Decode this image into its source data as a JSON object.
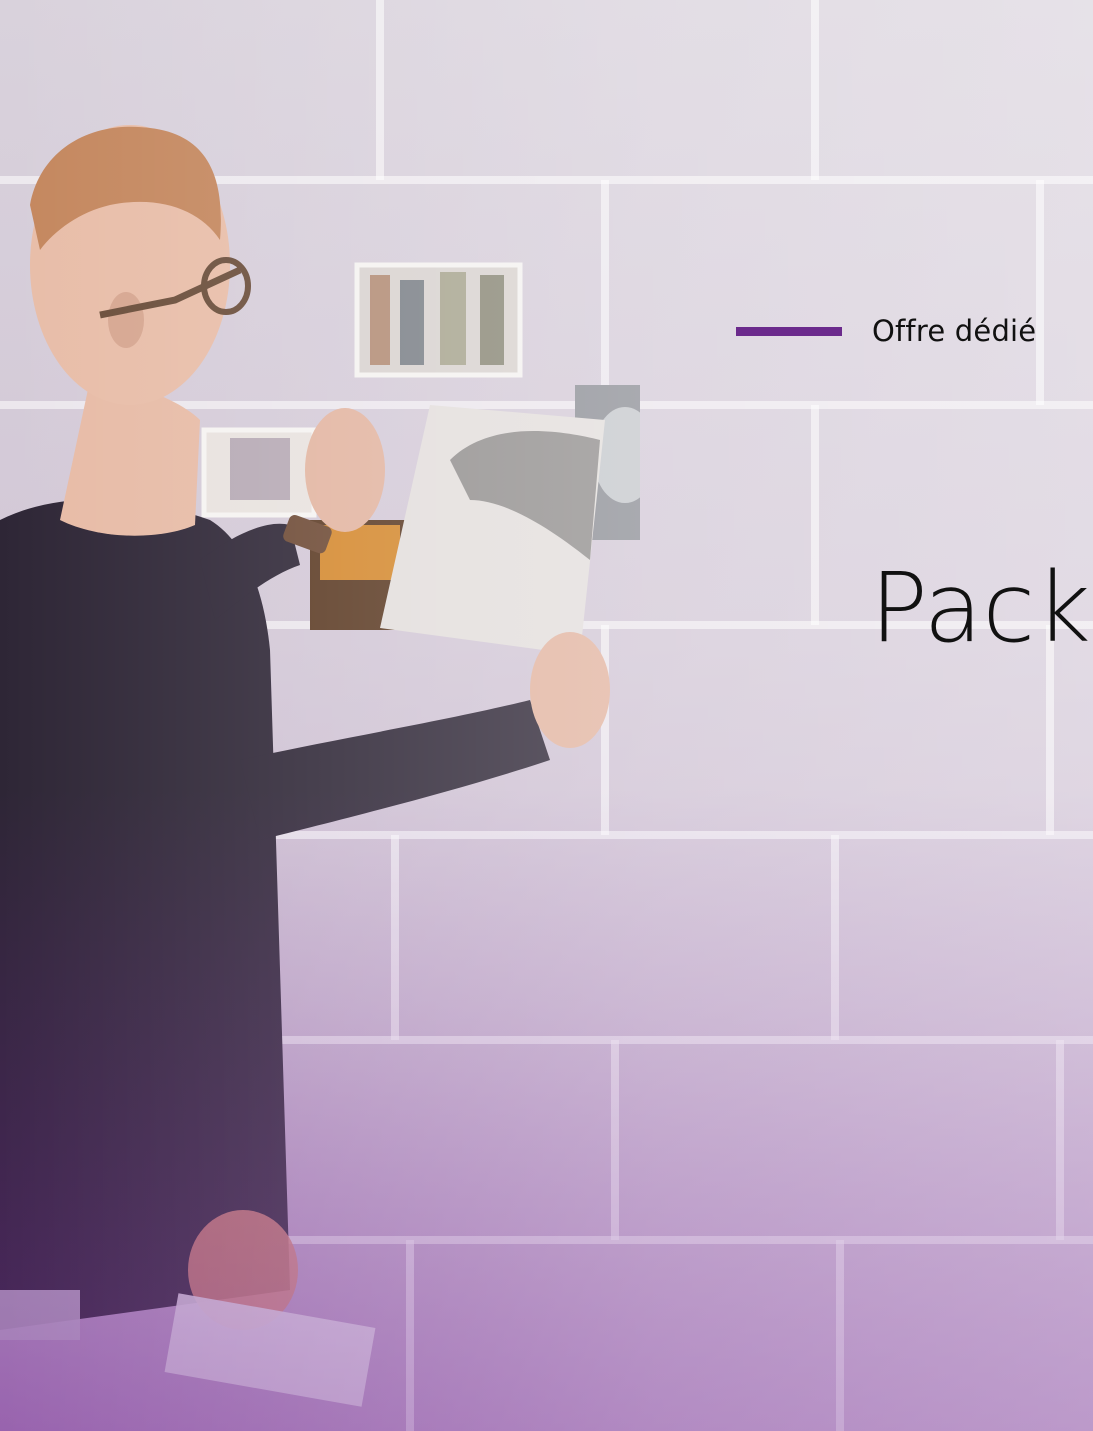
{
  "banner": {
    "background_image": "man-pinning-photos-on-brick-wall",
    "eyebrow_text": "Offre dédié",
    "headline_text": "Pack’",
    "accent_color": "#6b2a8c",
    "text_color": "#111111"
  }
}
